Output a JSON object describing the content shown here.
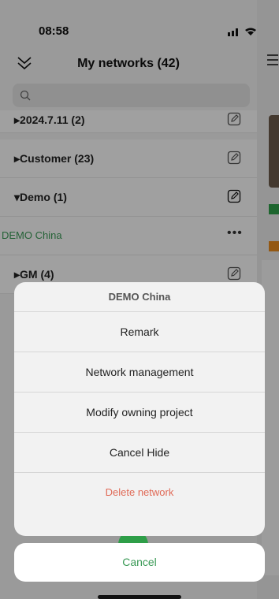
{
  "status_bar": {
    "time": "08:58"
  },
  "header": {
    "title": "My networks (42)"
  },
  "search": {
    "placeholder": ""
  },
  "groups": [
    {
      "label": "▸2024.7.11 (2)"
    },
    {
      "label": "▸Customer (23)"
    },
    {
      "label": "▾Demo (1)"
    },
    {
      "label": "DEMO China"
    },
    {
      "label": "▸GM (4)"
    }
  ],
  "action_sheet": {
    "title": "DEMO China",
    "items": [
      "Remark",
      "Network management",
      "Modify owning project",
      "Cancel Hide"
    ],
    "delete_label": "Delete network",
    "cancel_label": "Cancel"
  },
  "colors": {
    "accent_green": "#3a9a56",
    "danger": "#e06a57"
  }
}
